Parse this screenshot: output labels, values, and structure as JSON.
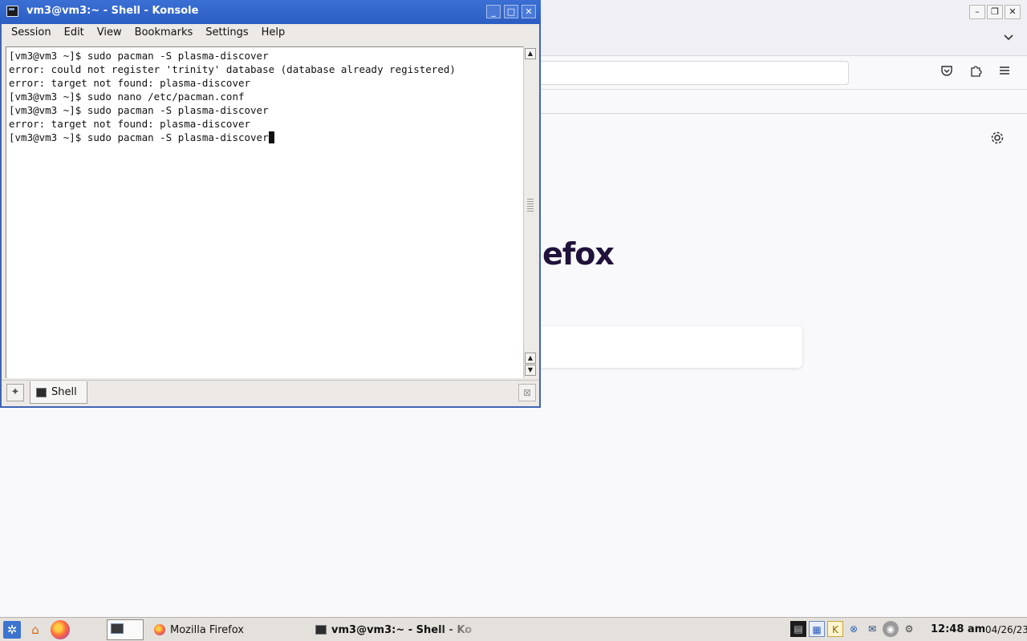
{
  "firefox": {
    "brand_text": "efox",
    "window_buttons": {
      "minimize": "–",
      "restore": "❐",
      "close": "✕"
    },
    "tab_list_icon": "chevron-down-icon",
    "toolbar_icons": [
      "pocket-icon",
      "extensions-icon",
      "menu-icon"
    ],
    "settings_icon": "gear-icon"
  },
  "konsole": {
    "title": "vm3@vm3:~ - Shell - Konsole",
    "window_buttons": {
      "minimize": "_",
      "maximize": "□",
      "close": "✕"
    },
    "menu": [
      "Session",
      "Edit",
      "View",
      "Bookmarks",
      "Settings",
      "Help"
    ],
    "terminal_lines": [
      "[vm3@vm3 ~]$ sudo pacman -S plasma-discover",
      "error: could not register 'trinity' database (database already registered)",
      "error: target not found: plasma-discover",
      "[vm3@vm3 ~]$ sudo nano /etc/pacman.conf",
      "[vm3@vm3 ~]$ sudo pacman -S plasma-discover",
      "error: target not found: plasma-discover",
      "[vm3@vm3 ~]$ sudo pacman -S plasma-discover"
    ],
    "tab_label": "Shell"
  },
  "taskbar": {
    "tasks": [
      {
        "label": "Mozilla Firefox"
      },
      {
        "label": "vm3@vm3:~ - Shell - Ko"
      }
    ],
    "tray_icons": [
      "terminal-icon",
      "calendar-icon",
      "klipper-icon",
      "network-icon",
      "mail-icon",
      "update-icon",
      "gear-tray-icon"
    ],
    "clock": "12:48 am",
    "date": "04/26/23"
  },
  "colors": {
    "konsole_titlebar": "#2c5ec2",
    "firefox_brand": "#20123a"
  }
}
